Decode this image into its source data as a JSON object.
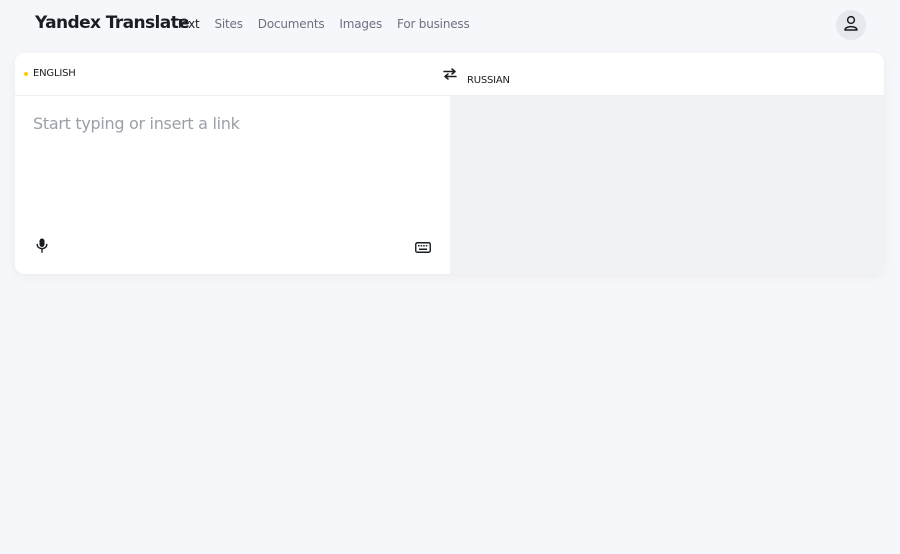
{
  "header": {
    "logo": "Yandex Translate",
    "nav": [
      {
        "label": "Text",
        "active": true
      },
      {
        "label": "Sites",
        "active": false
      },
      {
        "label": "Documents",
        "active": false
      },
      {
        "label": "Images",
        "active": false
      },
      {
        "label": "For business",
        "active": false
      }
    ],
    "avatar_icon": "user-icon"
  },
  "translator": {
    "source_language": "ENGLISH",
    "target_language": "RUSSIAN",
    "swap_icon": "swap-arrows-icon",
    "source_placeholder": "Start typing or insert a link",
    "source_value": "",
    "mic_icon": "microphone-icon",
    "keyboard_icon": "keyboard-icon",
    "target_text": ""
  },
  "colors": {
    "background": "#f6f7fa",
    "panel": "#ffffff",
    "target_panel": "#f1f2f5",
    "accent_dot": "#ffcc00",
    "text_primary": "#1a1d21",
    "text_secondary": "#6b7280"
  }
}
